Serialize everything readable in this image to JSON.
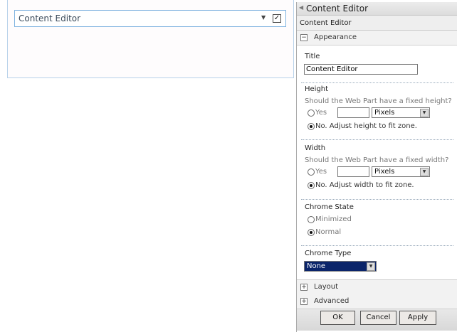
{
  "webpart": {
    "title": "Content Editor",
    "menu_icon": "dropdown-arrow-icon",
    "checkbox_checked": true
  },
  "pane": {
    "header": "Content Editor",
    "subheader": "Content Editor",
    "appearance": {
      "label": "Appearance",
      "expanded": true
    },
    "title_label": "Title",
    "title_value": "Content Editor",
    "height": {
      "label": "Height",
      "question": "Should the Web Part have a fixed height?",
      "yes": "Yes",
      "unit": "Pixels",
      "no": "No. Adjust height to fit zone.",
      "selected": "no"
    },
    "width": {
      "label": "Width",
      "question": "Should the Web Part have a fixed width?",
      "yes": "Yes",
      "unit": "Pixels",
      "no": "No. Adjust width to fit zone.",
      "selected": "no"
    },
    "chrome_state": {
      "label": "Chrome State",
      "minimized": "Minimized",
      "normal": "Normal",
      "selected": "normal"
    },
    "chrome_type": {
      "label": "Chrome Type",
      "value": "None"
    },
    "layout": "Layout",
    "advanced": "Advanced",
    "buttons": {
      "ok": "OK",
      "cancel": "Cancel",
      "apply": "Apply"
    }
  }
}
